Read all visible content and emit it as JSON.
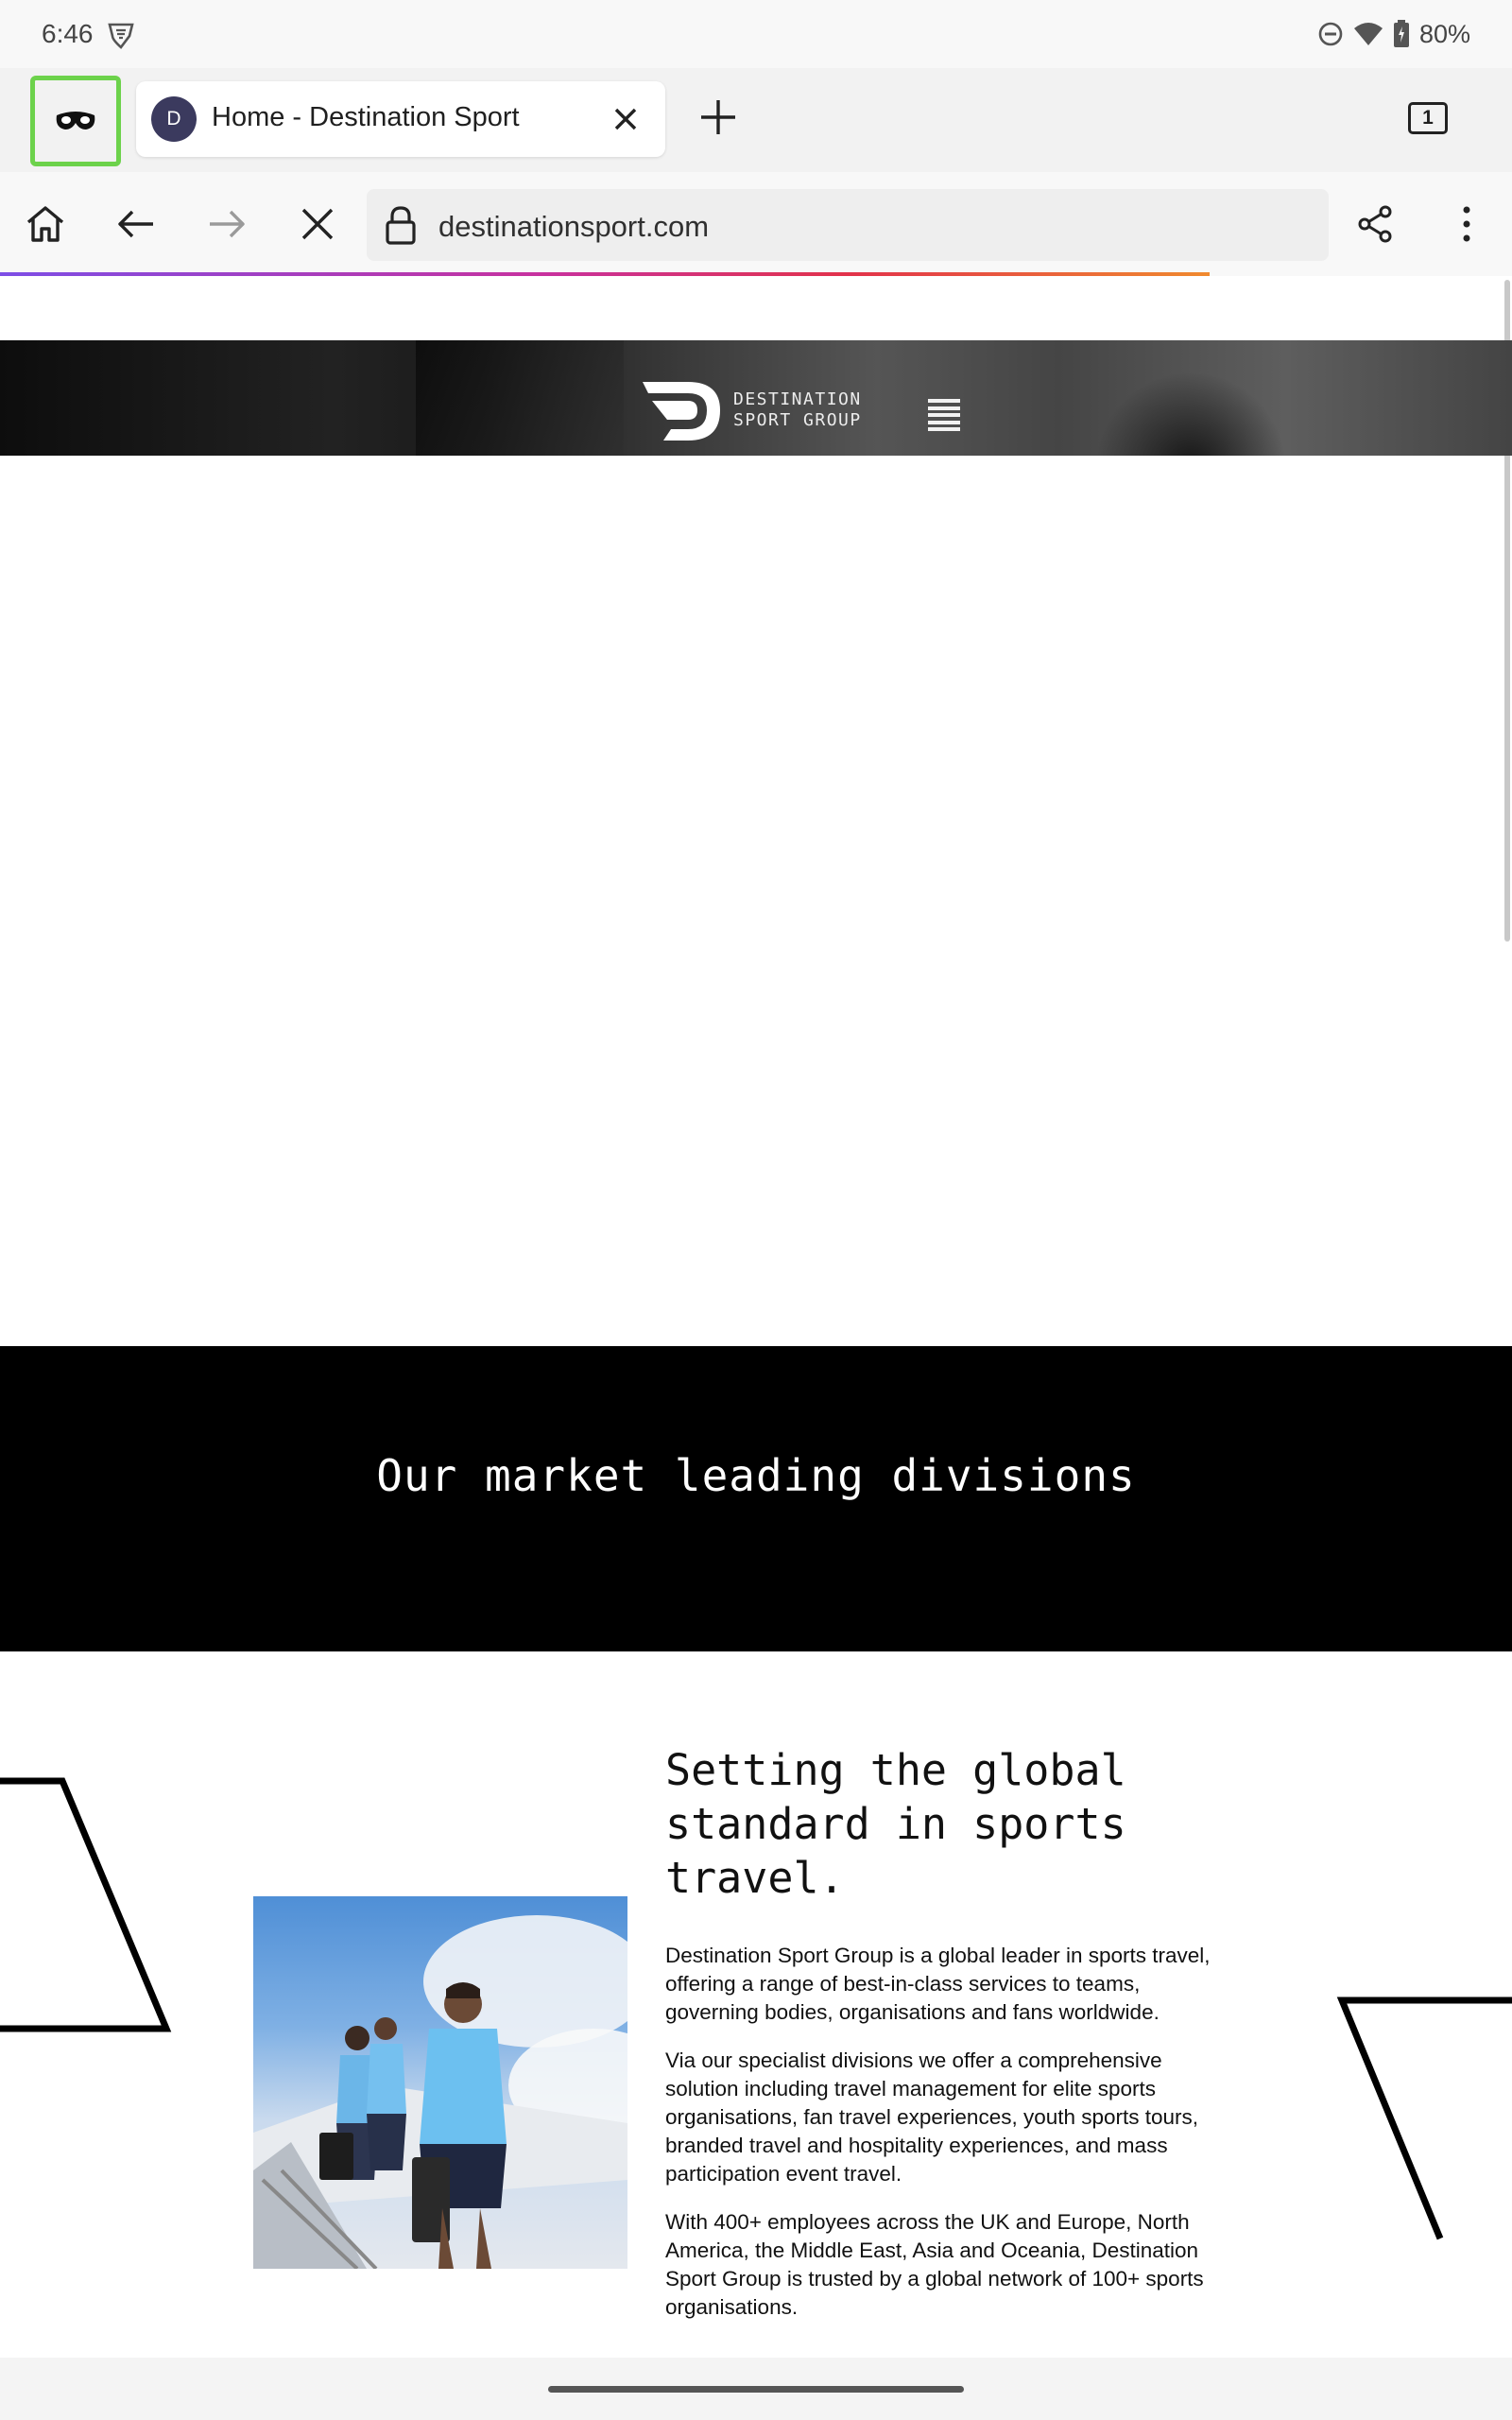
{
  "status_bar": {
    "time": "6:46",
    "battery": "80%",
    "icons": [
      "vpn-shield-icon",
      "do-not-disturb-icon",
      "wifi-icon",
      "battery-icon"
    ]
  },
  "tabs": {
    "incognito_icon": "incognito-mask-icon",
    "active_tab": {
      "favicon_letter": "D",
      "title": "Home - Destination Sport"
    },
    "tab_count": "1"
  },
  "toolbar": {
    "url": "destinationsport.com",
    "icons": [
      "home-icon",
      "back-icon",
      "forward-icon",
      "stop-icon",
      "lock-icon",
      "share-icon",
      "more-icon"
    ]
  },
  "site": {
    "logo_text_line1": "DESTINATION",
    "logo_text_line2": "SPORT GROUP",
    "divisions_title": "Our market leading divisions",
    "about_heading": "Setting the global standard in sports travel.",
    "about_paragraphs": [
      "Destination Sport Group is a global leader in sports travel, offering a range of best-in-class services to teams, governing bodies, organisations and fans worldwide.",
      "Via our specialist divisions we offer a comprehensive solution including travel management for elite sports organisations, fan travel experiences, youth sports tours, branded travel and hospitality experiences, and mass participation event travel.",
      "With 400+ employees across the UK and Europe, North America, the Middle East, Asia and Oceania, Destination Sport Group is trusted by a global network of 100+ sports organisations."
    ]
  },
  "colors": {
    "incognito_highlight": "#6cd24b",
    "favicon_bg": "#3b3a5e",
    "divisions_band": "#000000"
  }
}
